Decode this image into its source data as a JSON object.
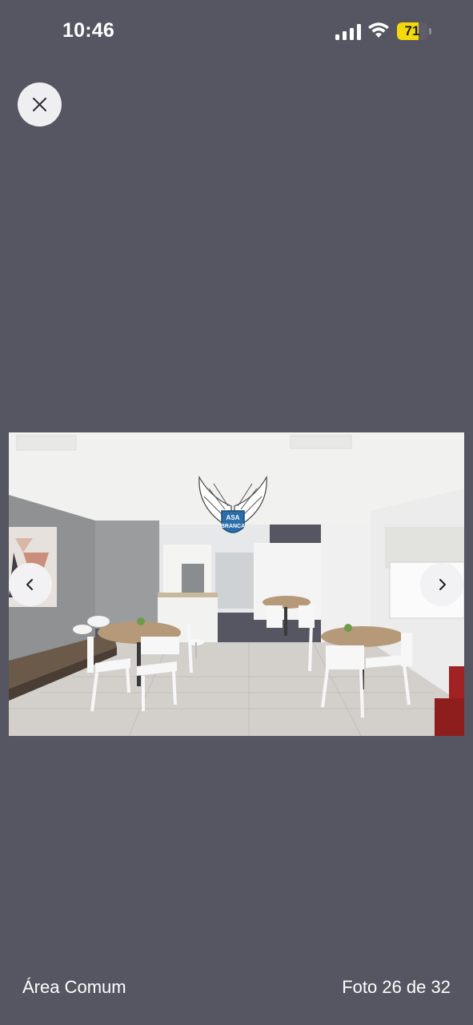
{
  "status_bar": {
    "time": "10:46",
    "signal_icon": "cellular-signal-icon",
    "wifi_icon": "wifi-icon",
    "battery_level": 71,
    "battery_label": "71",
    "battery_color": "#f5d90a"
  },
  "viewer": {
    "close_icon": "close-icon",
    "prev_icon": "chevron-left-icon",
    "next_icon": "chevron-right-icon",
    "background_color": "#565562"
  },
  "photo": {
    "watermark_name_line1": "ASA",
    "watermark_name_line2": "BRANCA"
  },
  "footer": {
    "caption": "Área Comum",
    "counter": "Foto 26 de 32"
  }
}
